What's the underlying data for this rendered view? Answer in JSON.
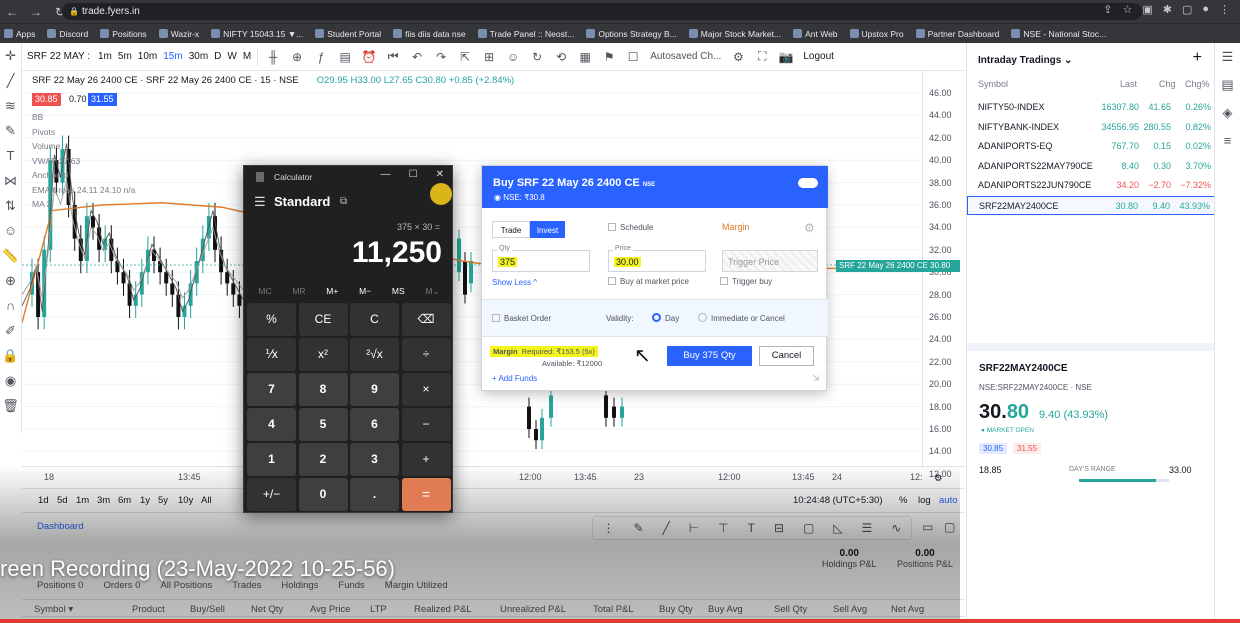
{
  "browser": {
    "url": "trade.fyers.in",
    "bookmarks": [
      "Apps",
      "Discord",
      "Positions",
      "Wazir-x",
      "NIFTY 15043.15 ▼...",
      "Student Portal",
      "fiis diis data nse",
      "Trade Panel :: Neost...",
      "Options Strategy B...",
      "Major Stock Market...",
      "Ant Web",
      "Upstox Pro",
      "Partner Dashboard",
      "NSE - National Stoc..."
    ]
  },
  "chart_toolbar": {
    "symbol": "SRF 22 MAY :",
    "timeframes": [
      "1m",
      "5m",
      "10m",
      "15m",
      "30m",
      "D",
      "W",
      "M"
    ],
    "autosave": "Autosaved Ch...",
    "logout": "Logout"
  },
  "chart": {
    "legend_title": "SRF 22 May 26 2400 CE · SRF 22 May 26 2400 CE · 15 · NSE",
    "ohlc": "O29.95 H33.00 L27.65 C30.80 +0.85 (+2.84%)",
    "bid": "30.85",
    "spread": "0.70",
    "ask": "31.55",
    "indicators": [
      {
        "label": "BB"
      },
      {
        "label": "Pivots"
      },
      {
        "label": "Volume"
      },
      {
        "label": "VWAP 27.63"
      },
      {
        "label": "Anchored"
      },
      {
        "label": "EMA Cross 24.11 24.10 n/a"
      },
      {
        "label": "MA 2"
      }
    ],
    "y_ticks": [
      "46.00",
      "44.00",
      "42.00",
      "40.00",
      "38.00",
      "36.00",
      "34.00",
      "32.00",
      "30.00",
      "28.00",
      "26.00",
      "24.00",
      "22.00",
      "20.00",
      "18.00",
      "16.00",
      "14.00",
      "12.00"
    ],
    "last_label": "SRF 22 May 26 2400 CE 30.80",
    "x_ticks": [
      "18",
      "13:45",
      "12:00",
      "13:45",
      "23",
      "12:00",
      "13:45",
      "24",
      "12:"
    ],
    "ranges": [
      "1d",
      "5d",
      "1m",
      "3m",
      "6m",
      "1y",
      "5y",
      "10y",
      "All"
    ],
    "clock": "10:24:48 (UTC+5:30)",
    "scale_opts": [
      "%",
      "log",
      "auto"
    ]
  },
  "calculator": {
    "title": "Calculator",
    "mode": "Standard",
    "expression": "375 × 30 =",
    "result": "11,250",
    "memory": [
      "MC",
      "MR",
      "M+",
      "M−",
      "MS",
      "M⌄"
    ],
    "keys": [
      "%",
      "CE",
      "C",
      "⌫",
      "⅟x",
      "x²",
      "²√x",
      "÷",
      "7",
      "8",
      "9",
      "×",
      "4",
      "5",
      "6",
      "−",
      "1",
      "2",
      "3",
      "+",
      "+/−",
      "0",
      ".",
      "="
    ]
  },
  "order": {
    "title": "Buy SRF 22 May 26 2400 CE",
    "exchange_tag": "NSE",
    "subtitle": "NSE: ₹30.8",
    "tab_trade": "Trade",
    "tab_invest": "Invest",
    "schedule": "Schedule",
    "margin_label": "Margin",
    "qty_label": "Qty",
    "qty_value": "375",
    "price_label": "Price",
    "price_value": "30.00",
    "trigger_placeholder": "Trigger Price",
    "show_less": "Show Less ^",
    "market_price": "Buy at market price",
    "trigger_buy": "Trigger buy",
    "basket": "Basket Order",
    "validity": "Validity:",
    "day": "Day",
    "ioc": "Immediate or Cancel",
    "margin_text": "Margin",
    "required_text": "Required:",
    "required_value": "₹153.5 (5x)",
    "available_text": "Available:",
    "available_value": "₹12000",
    "add_funds": "+ Add Funds",
    "buy_button": "Buy 375 Qty",
    "cancel_button": "Cancel"
  },
  "watchlist": {
    "title": "Intraday Tradings",
    "cols": [
      "Symbol",
      "Last",
      "Chg",
      "Chg%"
    ],
    "rows": [
      {
        "symbol": "NIFTY50-INDEX",
        "last": "16307.80",
        "chg": "41.65",
        "pct": "0.26%",
        "dir": "pos"
      },
      {
        "symbol": "NIFTYBANK-INDEX",
        "last": "34556.95",
        "chg": "280.55",
        "pct": "0.82%",
        "dir": "pos"
      },
      {
        "symbol": "ADANIPORTS-EQ",
        "last": "767.70",
        "chg": "0.15",
        "pct": "0.02%",
        "dir": "pos"
      },
      {
        "symbol": "ADANIPORTS22MAY790CE",
        "last": "8.40",
        "chg": "0.30",
        "pct": "3.70%",
        "dir": "pos"
      },
      {
        "symbol": "ADANIPORTS22JUN790CE",
        "last": "34.20",
        "chg": "−2.70",
        "pct": "−7.32%",
        "dir": "neg"
      },
      {
        "symbol": "SRF22MAY2400CE",
        "last": "30.80",
        "chg": "9.40",
        "pct": "43.93%",
        "dir": "pos"
      }
    ]
  },
  "detail": {
    "symbol": "SRF22MAY2400CE",
    "sub": "NSE:SRF22MAY2400CE · NSE",
    "price_main": "30.",
    "price_dec": "80",
    "change": "9.40 (43.93%)",
    "status": "● MARKET OPEN",
    "bid": "30.85",
    "ask": "31.55",
    "low": "18.85",
    "range_label": "DAY'S RANGE",
    "high": "33.00",
    "range_fraction": 0.85
  },
  "dashboard": {
    "tab": "Dashboard",
    "tabs": [
      "Positions 0",
      "Orders 0",
      "All Positions",
      "Trades",
      "Holdings",
      "Funds",
      "Margin Utilized"
    ],
    "cols": [
      "Symbol ▾",
      "Product",
      "Buy/Sell",
      "Net Qty",
      "Avg Price",
      "LTP",
      "Realized P&L",
      "Unrealized P&L",
      "Total P&L",
      "Buy Qty",
      "Buy Avg",
      "Sell Qty",
      "Sell Avg",
      "Net Avg"
    ],
    "holdings_val": "0.00",
    "holdings_lbl": "Holdings P&L",
    "positions_val": "0.00",
    "positions_lbl": "Positions P&L"
  },
  "recording": "reen Recording (23-May-2022 10-25-56)",
  "colors": {
    "up": "#26a69a",
    "down": "#000000",
    "accent": "#2962ff",
    "vwap": "#e07c2a"
  }
}
